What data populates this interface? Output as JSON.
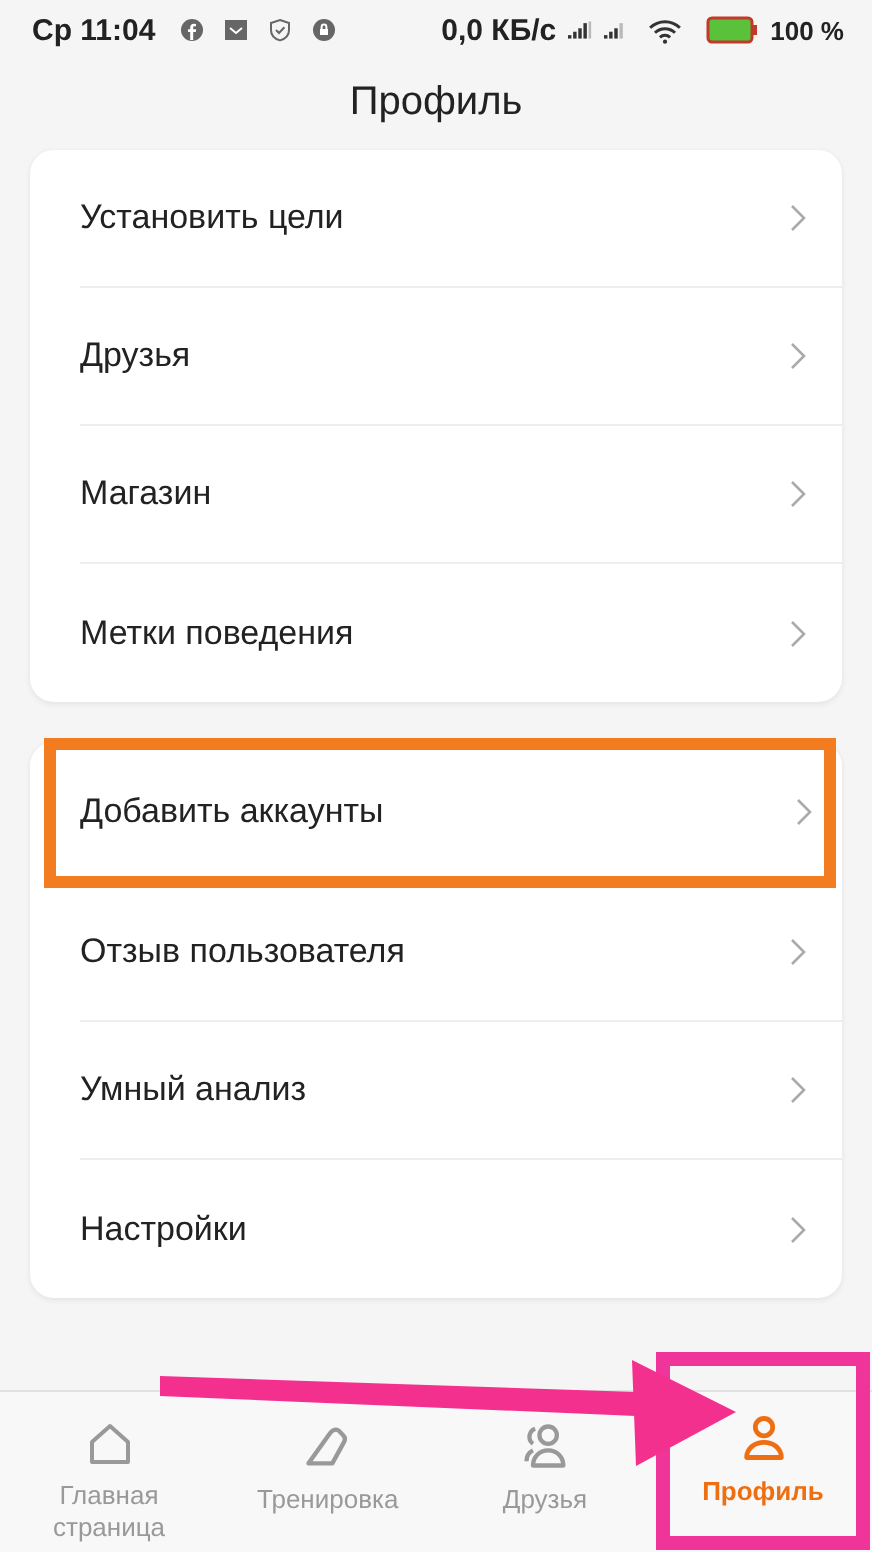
{
  "status_bar": {
    "time": "Ср 11:04",
    "speed": "0,0 КБ/с",
    "battery": "100 %"
  },
  "title": "Профиль",
  "groups": [
    {
      "items": [
        {
          "label": "Установить цели",
          "highlighted": false
        },
        {
          "label": "Друзья",
          "highlighted": false
        },
        {
          "label": "Магазин",
          "highlighted": false
        },
        {
          "label": "Метки поведения",
          "highlighted": false
        }
      ]
    },
    {
      "items": [
        {
          "label": "Добавить аккаунты",
          "highlighted": true
        },
        {
          "label": "Отзыв пользователя",
          "highlighted": false
        },
        {
          "label": "Умный анализ",
          "highlighted": false
        },
        {
          "label": "Настройки",
          "highlighted": false
        }
      ]
    }
  ],
  "nav": [
    {
      "kind": "home",
      "label": "Главная страница",
      "selected": false,
      "highlighted": false
    },
    {
      "kind": "workout",
      "label": "Тренировка",
      "selected": false,
      "highlighted": false
    },
    {
      "kind": "friends",
      "label": "Друзья",
      "selected": false,
      "highlighted": false
    },
    {
      "kind": "profile",
      "label": "Профиль",
      "selected": true,
      "highlighted": true
    }
  ],
  "annotation_arrow": true
}
